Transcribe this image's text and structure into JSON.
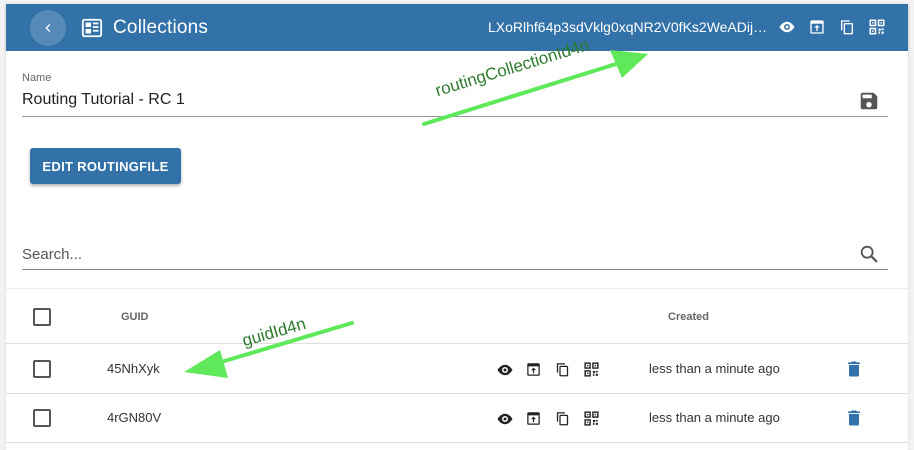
{
  "appbar": {
    "title": "Collections",
    "id_text": "LXoRlhf64p3sdVklg0xqNR2V0fKs2WeADijq..."
  },
  "form": {
    "name_label": "Name",
    "name_value": "Routing Tutorial - RC 1",
    "edit_button": "EDIT ROUTINGFILE"
  },
  "search": {
    "placeholder": "Search..."
  },
  "table": {
    "headers": {
      "guid": "GUID",
      "created": "Created"
    },
    "rows": [
      {
        "guid": "45NhXyk",
        "created": "less than a minute ago"
      },
      {
        "guid": "4rGN80V",
        "created": "less than a minute ago"
      }
    ]
  },
  "annotations": {
    "routing": "routingCollectionId4n",
    "guid": "guidId4n"
  },
  "colors": {
    "primary": "#3272a8",
    "annotation": "#5ee85a",
    "annotation_text": "#2d7a2d"
  }
}
